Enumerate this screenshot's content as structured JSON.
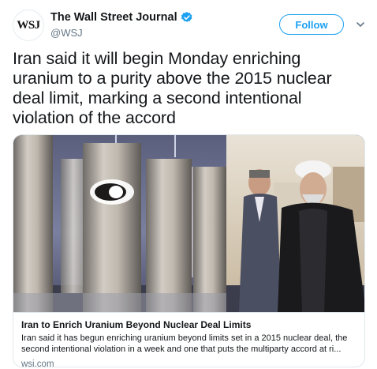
{
  "account": {
    "display_name": "The Wall Street Journal",
    "handle": "@WSJ",
    "avatar_text": "WSJ",
    "verified": true
  },
  "follow_label": "Follow",
  "tweet": {
    "text": "Iran said it will begin Monday enriching uranium to a purity above the 2015 nuclear deal limit, marking a second intentional violation of the accord"
  },
  "card": {
    "title": "Iran to Enrich Uranium Beyond Nuclear Deal Limits",
    "description": "Iran said it has begun enriching uranium beyond limits set in a 2015 nuclear deal, the second intentional violation in a week and one that puts the multiparty accord at ri...",
    "domain": "wsj.com"
  },
  "colors": {
    "accent": "#1da1f2",
    "secondary_text": "#657786",
    "primary_text": "#14171a"
  },
  "icons": {
    "verified": "verified-badge-icon",
    "more": "chevron-down-icon"
  }
}
